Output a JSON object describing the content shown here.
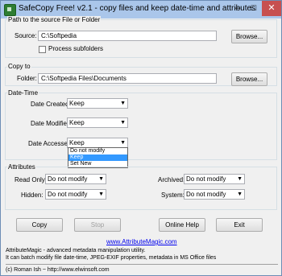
{
  "window": {
    "title": "SafeCopy Free! v2.1 - copy files and keep date-time and attributes",
    "min_glyph": "–",
    "max_glyph": "□",
    "close_glyph": "✕"
  },
  "source": {
    "section_label": "Path to the source File or Folder",
    "field_label": "Source:",
    "value": "C:\\Softpedia",
    "browse_label": "Browse...",
    "subfolders_label": "Process subfolders",
    "subfolders_checked": false
  },
  "copyto": {
    "section_label": "Copy to",
    "field_label": "Folder:",
    "value": "C:\\Softpedia Files\\Documents",
    "browse_label": "Browse..."
  },
  "datetime": {
    "section_label": "Date-Time",
    "created_label": "Date Created:",
    "created_value": "Keep",
    "modified_label": "Date Modified:",
    "modified_value": "Keep",
    "accessed_label": "Date Accessed:",
    "accessed_value": "Keep",
    "dropdown_options": [
      "Do not modify",
      "Keep",
      "Set New"
    ],
    "dropdown_selected_index": 1
  },
  "attributes": {
    "section_label": "Attributes",
    "readonly_label": "Read Only:",
    "readonly_value": "Do not modify",
    "hidden_label": "Hidden:",
    "hidden_value": "Do not modify",
    "archived_label": "Archived:",
    "archived_value": "Do not modify",
    "system_label": "System:",
    "system_value": "Do not modify"
  },
  "buttons": {
    "copy": "Copy",
    "stop": "Stop",
    "help": "Online Help",
    "exit": "Exit"
  },
  "footer": {
    "link": "www.AttributeMagic.com",
    "line1": "AttributeMagic - advanced metadata manipulation utility.",
    "line2": "It can batch modify file date-time, JPEG-EXIF properties, metadata in MS Office files",
    "copyright": "(c) Roman Ish   ~   http://www.elwinsoft.com"
  }
}
